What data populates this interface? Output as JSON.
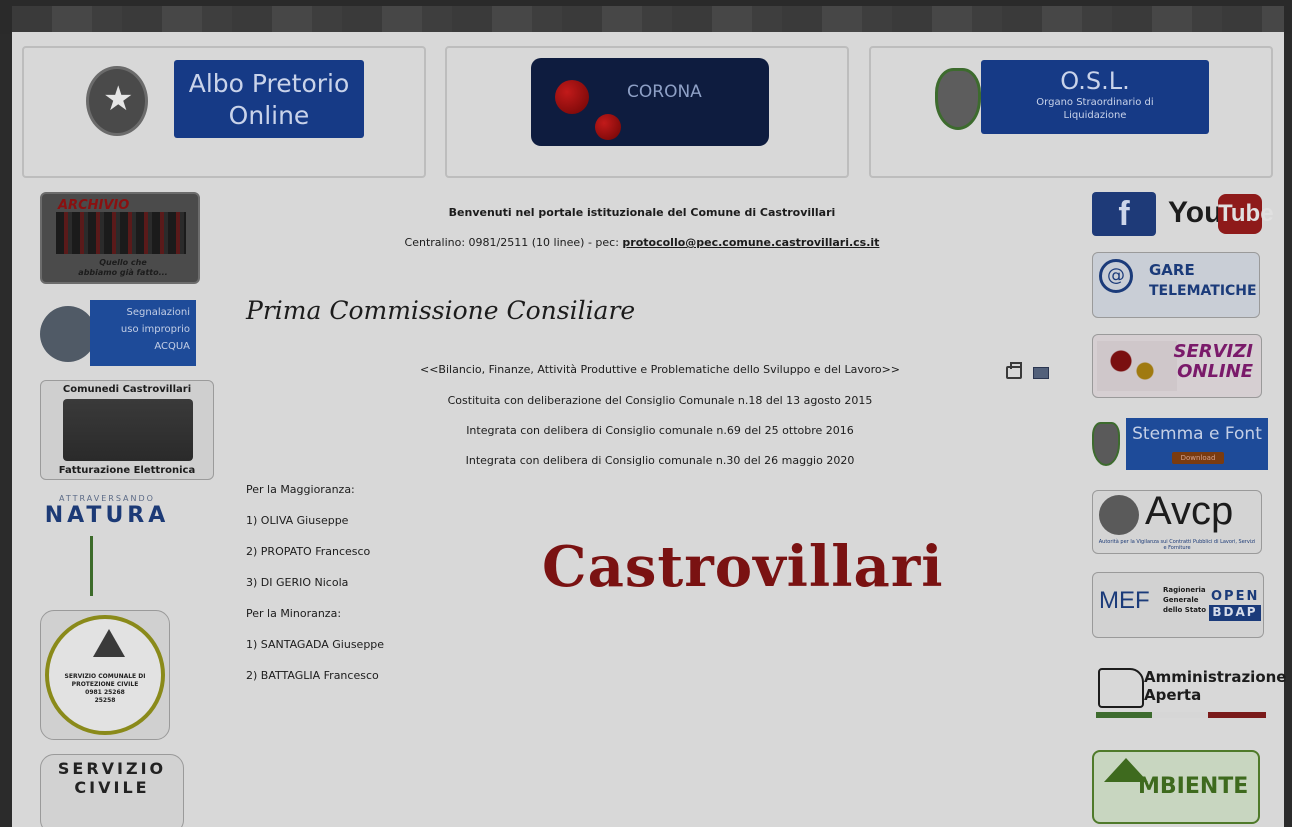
{
  "banners": {
    "albo": {
      "line1": "Albo Pretorio",
      "line2": "Online"
    },
    "corona": {
      "label": "CORONA"
    },
    "osl": {
      "title": "O.S.L.",
      "line1": "Organo Straordinario di",
      "line2": "Liquidazione"
    }
  },
  "left_sidebar": {
    "archivio": {
      "title": "ARCHIVIO",
      "sub1": "Quello che",
      "sub2": "abbiamo già fatto..."
    },
    "acqua": {
      "line1": "Segnalazioni",
      "line2": "uso improprio",
      "line3": "ACQUA"
    },
    "fatturazione": {
      "top": "Comunedi Castrovillari",
      "bottom": "Fatturazione Elettronica"
    },
    "natura": {
      "small": "ATTRAVERSANDO",
      "big": "NATURA"
    },
    "protezione": {
      "line1": "SERVIZIO COMUNALE DI",
      "line2": "PROTEZIONE CIVILE",
      "phone1": "0981 25268",
      "phone2": "25258"
    },
    "servizio_civile": {
      "text": "SERVIZIO CIVILE"
    }
  },
  "right_sidebar": {
    "facebook": "f",
    "youtube_you": "You",
    "youtube_tube": "Tube",
    "gare": {
      "line1": "GARE",
      "line2": "TELEMATICHE"
    },
    "servizi": {
      "line1": "SERVIZI",
      "line2": "ONLINE"
    },
    "stemma": {
      "label": "Stemma e Font",
      "download": "Download"
    },
    "avcp": {
      "title": "Avcp",
      "sub": "Autorità per la Vigilanza sui Contratti Pubblici di Lavori, Servizi e Forniture"
    },
    "mef": {
      "title": "MEF",
      "sub1": "Ragioneria",
      "sub2": "Generale",
      "sub3": "dello Stato",
      "open": "OPEN",
      "bdap": "BDAP"
    },
    "amministrazione": {
      "line1": "Amministrazione",
      "line2": "Aperta"
    },
    "ambiente": {
      "label": "MBIENTE"
    }
  },
  "content": {
    "welcome": "Benvenuti nel portale istituzionale del Comune di Castrovillari",
    "centralino_prefix": "Centralino: 0981/2511 (10 linee) - pec: ",
    "pec_email": "protocollo@pec.comune.castrovillari.cs.it",
    "heading": "Prima Commissione Consiliare",
    "subtitle": "<<Bilancio, Finanze, Attività Produttive e Problematiche dello Sviluppo e del Lavoro>>",
    "line2": "Costituita con deliberazione del Consiglio Comunale n.18 del 13 agosto 2015",
    "line3": "Integrata con delibera di Consiglio comunale n.69 del 25 ottobre 2016",
    "line4": "Integrata con delibera di Consiglio comunale n.30 del 26 maggio 2020",
    "maggioranza_label": "Per la Maggioranza:",
    "maggioranza": [
      "1) OLIVA Giuseppe",
      "2) PROPATO Francesco",
      "3) DI GERIO Nicola"
    ],
    "minoranza_label": "Per la Minoranza:",
    "minoranza": [
      "1) SANTAGADA Giuseppe",
      "2) BATTAGLIA Francesco"
    ],
    "watermark": "Castrovillari"
  }
}
